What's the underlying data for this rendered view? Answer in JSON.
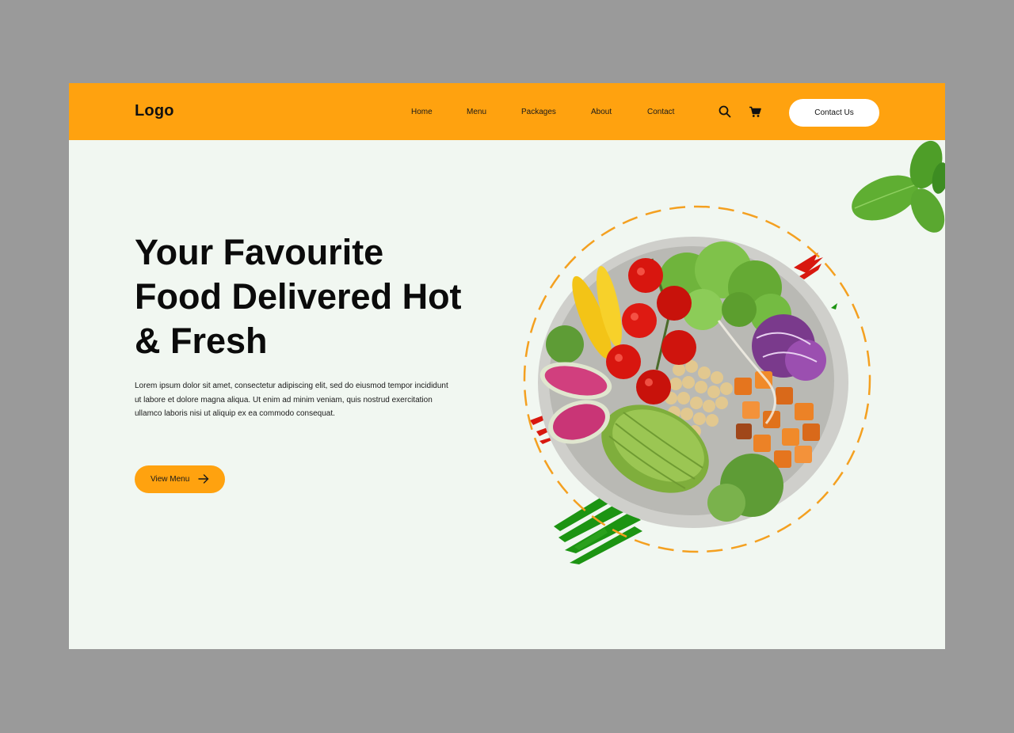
{
  "nav": {
    "logo": "Logo",
    "links": [
      "Home",
      "Menu",
      "Packages",
      "About",
      "Contact"
    ],
    "search_icon": "search-icon",
    "cart_icon": "cart-icon",
    "cta_label": "Contact Us"
  },
  "hero": {
    "title_lines": [
      "Your Favourite",
      "Food Delivered Hot",
      "& Fresh"
    ],
    "description_lines": [
      "Lorem ipsum dolor sit amet, consectetur adipiscing elit, sed do eiusmod tempor incididunt",
      "ut labore et dolore magna aliqua. Ut enim ad minim veniam, quis nostrud exercitation",
      "ullamco laboris nisi ut aliquip ex ea commodo consequat."
    ],
    "cta_label": "View Menu",
    "cta_icon": "arrow-right-icon"
  },
  "illustration": {
    "dish": "salad-bowl-illustration",
    "decoration": "basil-leaf-illustration"
  },
  "colors": {
    "accent": "#ffa20f",
    "page_background": "#f1f7f1",
    "outer_background": "#9a9a9a",
    "text": "#0b0b0b"
  }
}
